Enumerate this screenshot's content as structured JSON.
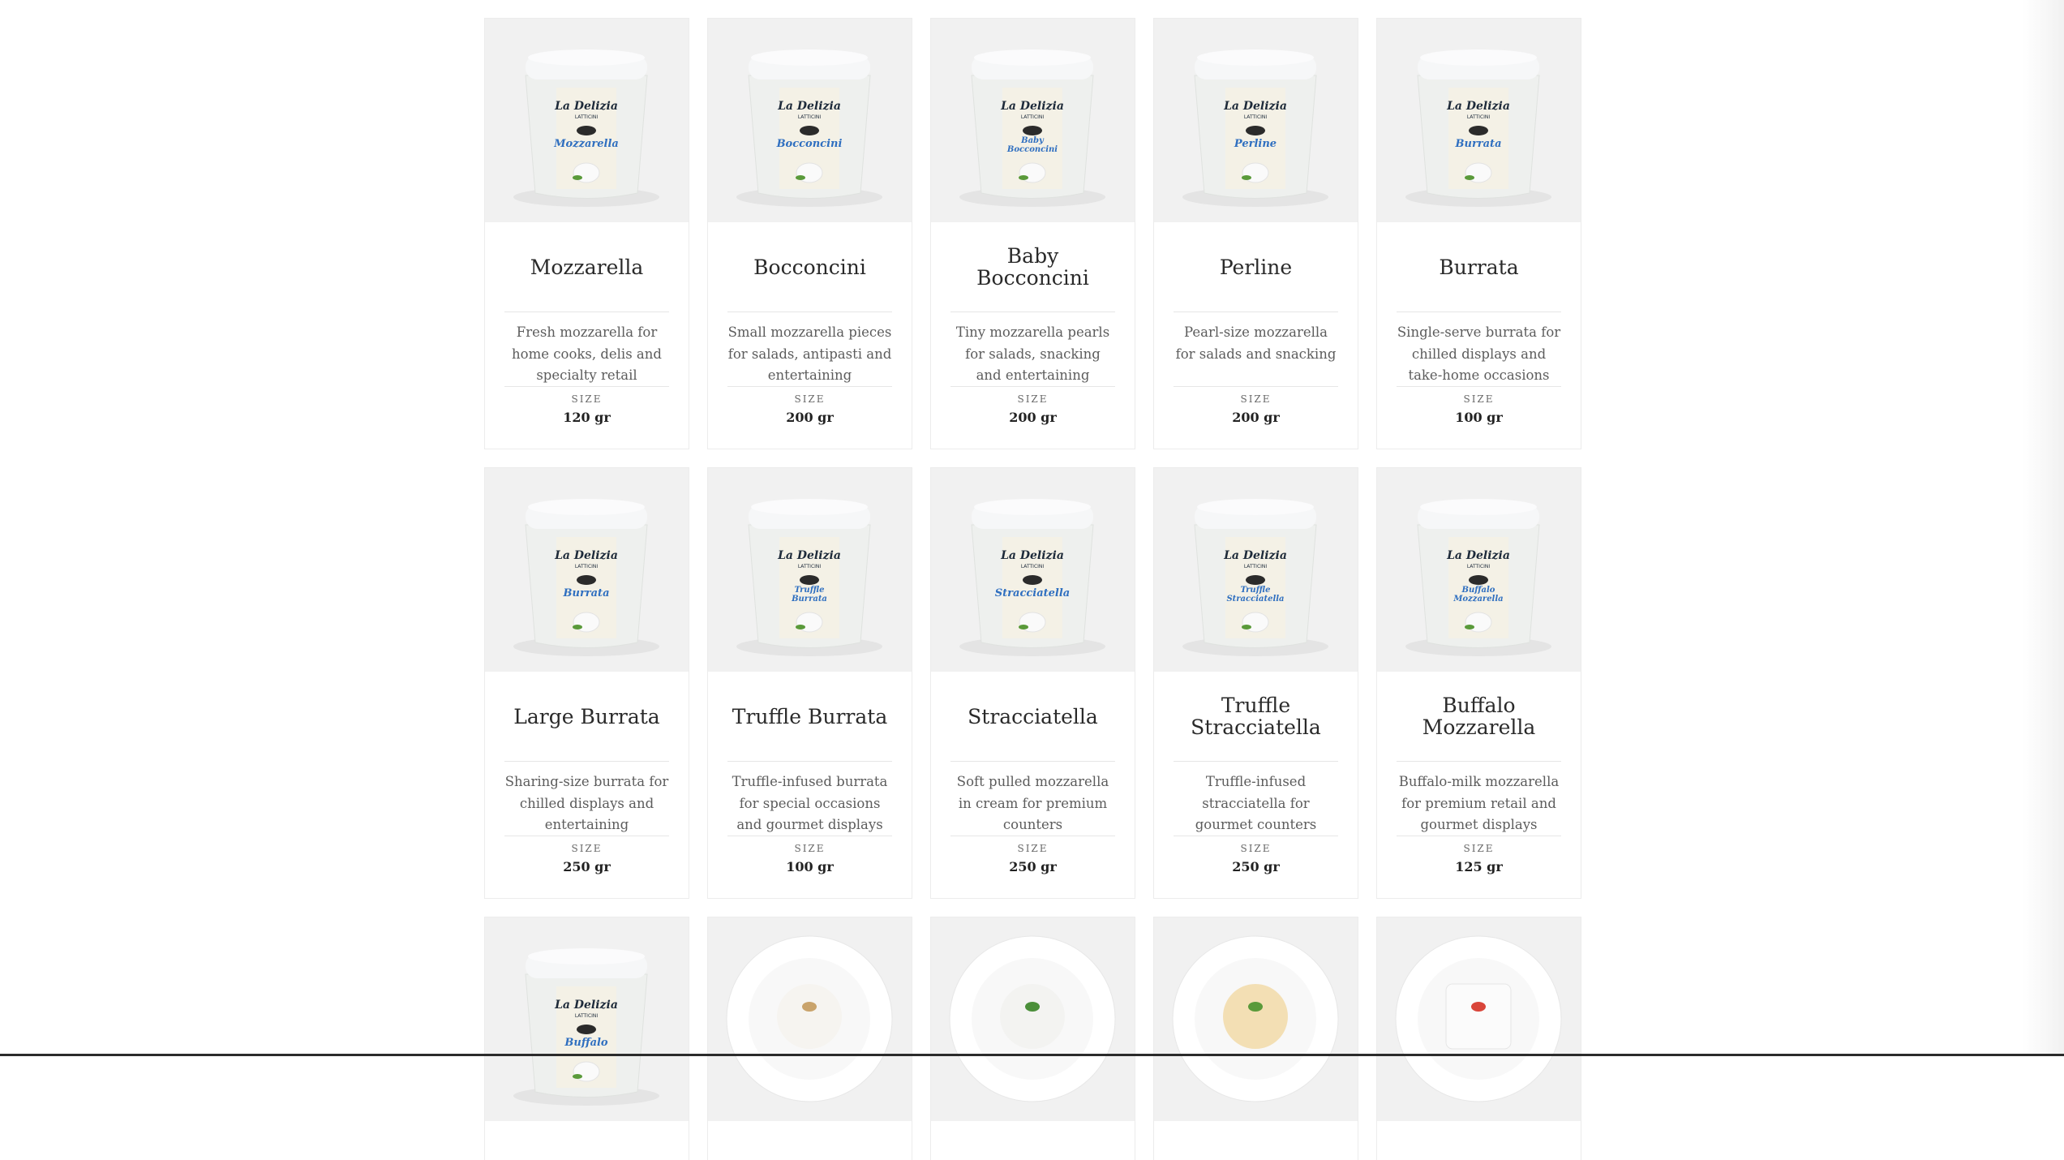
{
  "brand": "La Delizia",
  "brand_sub": "LATTICINI",
  "size_label": "SIZE",
  "products": [
    {
      "name": "Mozzarella",
      "desc": "Fresh mozzarella for home cooks, delis and specialty retail",
      "size": "120 gr",
      "tub_label": "Mozzarella",
      "kind": "tub"
    },
    {
      "name": "Bocconcini",
      "desc": "Small mozzarella pieces for salads, antipasti and entertaining",
      "size": "200 gr",
      "tub_label": "Bocconcini",
      "kind": "tub"
    },
    {
      "name": "Baby Bocconcini",
      "desc": "Tiny mozzarella pearls for salads, snacking and entertaining",
      "size": "200 gr",
      "tub_label": "Baby Bocconcini",
      "kind": "tub"
    },
    {
      "name": "Perline",
      "desc": "Pearl-size mozzarella for salads and snacking",
      "size": "200 gr",
      "tub_label": "Perline",
      "kind": "tub"
    },
    {
      "name": "Burrata",
      "desc": "Single-serve burrata for chilled displays and take-home occasions",
      "size": "100 gr",
      "tub_label": "Burrata",
      "kind": "tub"
    },
    {
      "name": "Large Burrata",
      "desc": "Sharing-size burrata for chilled displays and entertaining",
      "size": "250 gr",
      "tub_label": "Burrata",
      "kind": "tub-wide"
    },
    {
      "name": "Truffle Burrata",
      "desc": "Truffle-infused burrata for special occasions and gourmet displays",
      "size": "100 gr",
      "tub_label": "Truffle Burrata",
      "kind": "tub"
    },
    {
      "name": "Stracciatella",
      "desc": "Soft pulled mozzarella in cream for premium counters",
      "size": "250 gr",
      "tub_label": "Stracciatella",
      "kind": "tub"
    },
    {
      "name": "Truffle Stracciatella",
      "desc": "Truffle-infused stracciatella for gourmet counters",
      "size": "250 gr",
      "tub_label": "Truffle Stracciatella",
      "kind": "tub"
    },
    {
      "name": "Buffalo Mozzarella",
      "desc": "Buffalo-milk mozzarella for premium retail and gourmet displays",
      "size": "125 gr",
      "tub_label": "Buffalo Mozzarella",
      "kind": "tub"
    }
  ],
  "partial_row": [
    {
      "kind": "tub",
      "tub_label": "Buffalo"
    },
    {
      "kind": "plate"
    },
    {
      "kind": "plate"
    },
    {
      "kind": "plate"
    },
    {
      "kind": "plate"
    }
  ]
}
